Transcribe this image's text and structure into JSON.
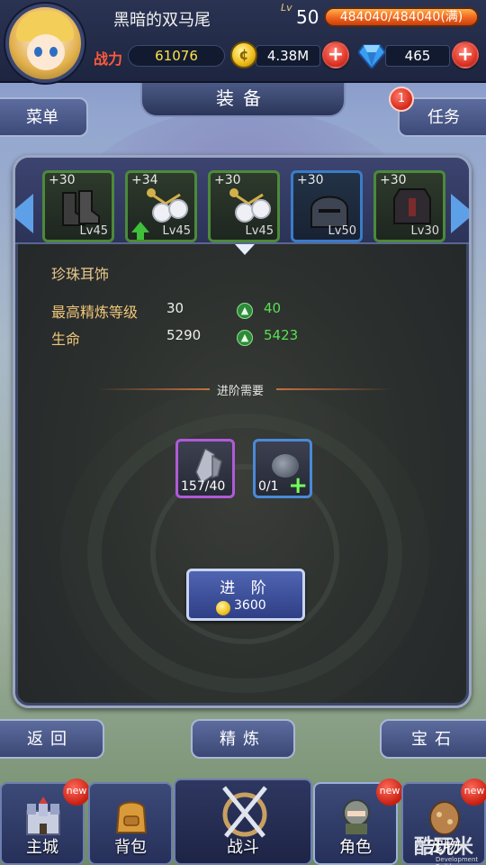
{
  "player": {
    "name": "黑暗的双马尾",
    "level_label": "Lv",
    "level": "50",
    "hp": "484040/484040(满)",
    "power_label": "战力",
    "power": "61076",
    "gold": "4.38M",
    "gems": "465"
  },
  "header": {
    "title": "装备",
    "menu_label": "菜单",
    "task_label": "任务",
    "task_badge": "1"
  },
  "equipment": {
    "slots": [
      {
        "plus": "+30",
        "level": "Lv45",
        "frame": "green",
        "icon": "boots-icon",
        "upgrade": false
      },
      {
        "plus": "+34",
        "level": "Lv45",
        "frame": "green",
        "icon": "pearl-earring-icon",
        "upgrade": true
      },
      {
        "plus": "+30",
        "level": "Lv45",
        "frame": "green",
        "icon": "pearl-earring-icon",
        "upgrade": false,
        "selected": true
      },
      {
        "plus": "+30",
        "level": "Lv50",
        "frame": "blue",
        "icon": "helmet-icon",
        "upgrade": false
      },
      {
        "plus": "+30",
        "level": "Lv30",
        "frame": "green",
        "icon": "chest-armor-icon",
        "upgrade": false
      }
    ]
  },
  "item": {
    "name": "珍珠耳饰",
    "stats": [
      {
        "label": "最高精炼等级",
        "current": "30",
        "next": "40"
      },
      {
        "label": "生命",
        "current": "5290",
        "next": "5423"
      }
    ]
  },
  "requirements": {
    "title": "进阶需要",
    "materials": [
      {
        "count": "157/40",
        "frame": "purple",
        "icon": "crystal-shard-icon"
      },
      {
        "count": "0/1",
        "frame": "blue",
        "icon": "ore-stone-icon",
        "addable": true
      }
    ]
  },
  "advance": {
    "label": "进 阶",
    "cost": "3600"
  },
  "actions": {
    "back": "返回",
    "refine": "精炼",
    "gem": "宝石"
  },
  "nav": {
    "items": [
      {
        "label": "主城",
        "icon": "castle-icon",
        "badge": "new"
      },
      {
        "label": "背包",
        "icon": "backpack-icon",
        "badge": ""
      },
      {
        "label": "战斗",
        "icon": "crossed-swords-icon",
        "badge": ""
      },
      {
        "label": "角色",
        "icon": "knight-helmet-icon",
        "badge": "new"
      },
      {
        "label": "宠物",
        "icon": "pet-egg-icon",
        "badge": "new"
      }
    ]
  },
  "footer": {
    "watermark": "酷玩米",
    "build": "Development Build"
  },
  "colors": {
    "power": "#ff5a3c",
    "stat_label": "#f0c67a",
    "stat_up": "#58e050",
    "item_name": "#e9c98c",
    "frame_green": "#4c8a3a",
    "frame_blue": "#3a7cc8",
    "frame_purple": "#b05ad8"
  }
}
